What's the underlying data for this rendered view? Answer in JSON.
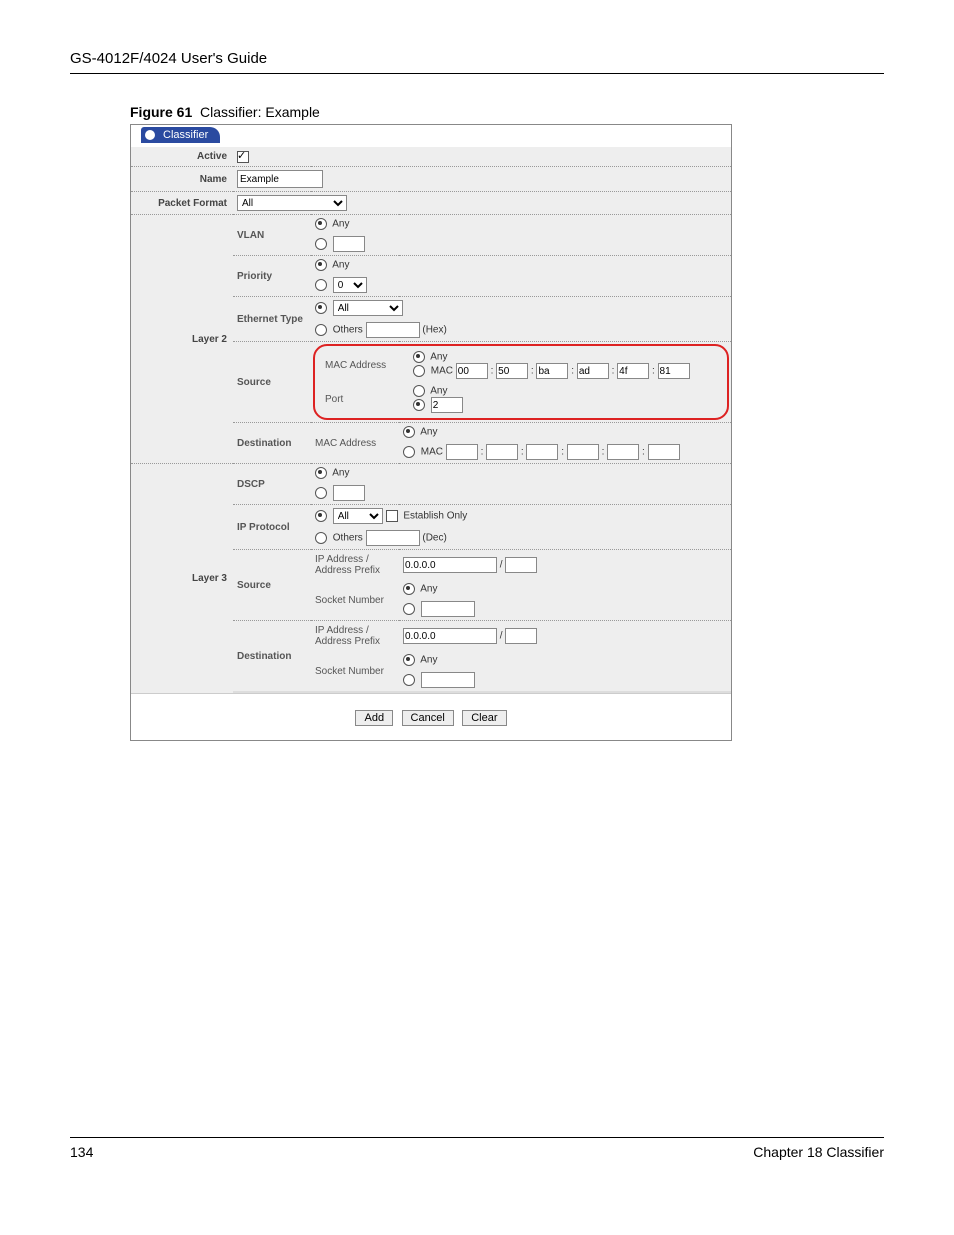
{
  "header": "GS-4012F/4024 User's Guide",
  "figure_label": "Figure 61",
  "figure_title": "Classifier: Example",
  "tab_title": "Classifier",
  "rows": {
    "active_label": "Active",
    "name_label": "Name",
    "name_value": "Example",
    "packet_format_label": "Packet Format",
    "packet_format_value": "All",
    "layer2_label": "Layer 2",
    "vlan_label": "VLAN",
    "any": "Any",
    "priority_label": "Priority",
    "priority_value": "0",
    "eth_type_label": "Ethernet Type",
    "eth_all": "All",
    "others": "Others",
    "hex": "(Hex)",
    "source_label": "Source",
    "mac_label": "MAC Address",
    "mac_word": "MAC",
    "mac_vals": [
      "00",
      "50",
      "ba",
      "ad",
      "4f",
      "81"
    ],
    "port_label": "Port",
    "port_value": "2",
    "dest_label": "Destination",
    "layer3_label": "Layer 3",
    "dscp_label": "DSCP",
    "ipproto_label": "IP Protocol",
    "establish_only": "Establish Only",
    "dec": "(Dec)",
    "ip_prefix": "IP Address / Address Prefix",
    "ip_value": "0.0.0.0",
    "socket_label": "Socket Number"
  },
  "buttons": {
    "add": "Add",
    "cancel": "Cancel",
    "clear": "Clear"
  },
  "footer_page": "134",
  "footer_chapter": "Chapter 18 Classifier"
}
